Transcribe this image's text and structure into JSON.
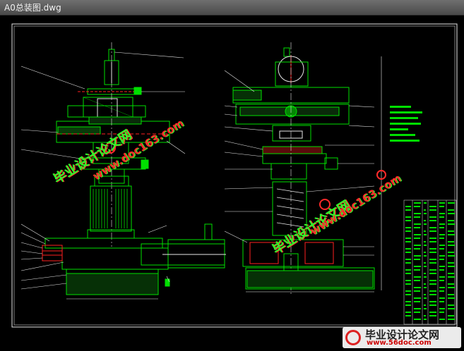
{
  "window": {
    "title": "A0总装图.dwg"
  },
  "watermarks": {
    "site_cn": "毕业设计论文网",
    "site_url": "www.doc163.com",
    "footer_cn": "毕业设计论文网",
    "footer_url": "www.56doc.com"
  },
  "colors": {
    "line": "#00e000",
    "white_line": "#e8e8e8",
    "red": "#ff2020",
    "watermark_green": "#2bff2b",
    "watermark_red": "#ff2a2a",
    "titlebar": "#5a5a5a"
  }
}
